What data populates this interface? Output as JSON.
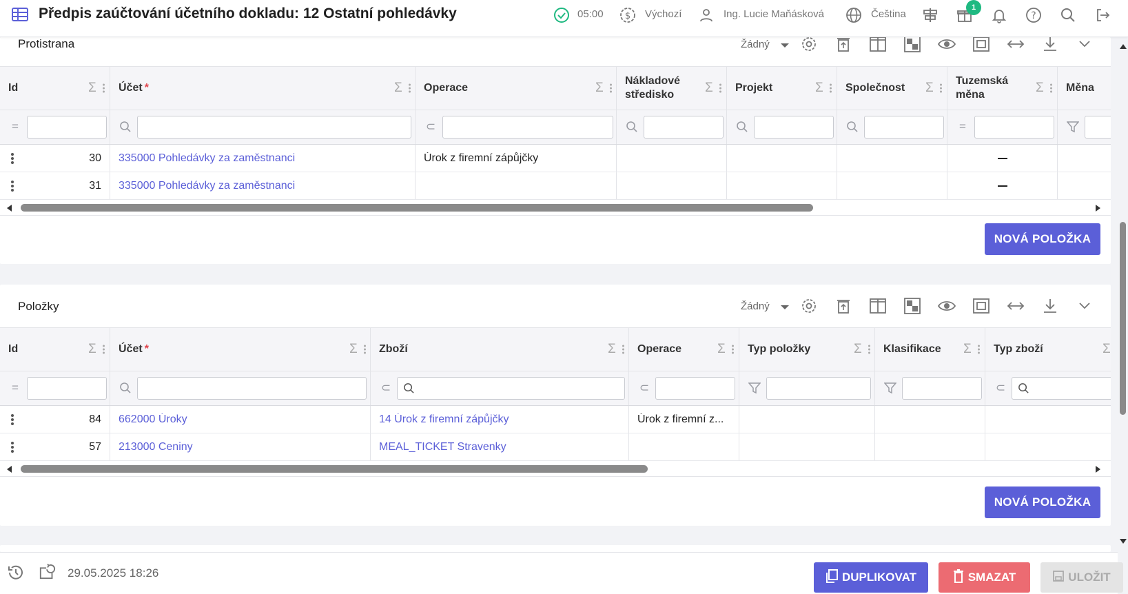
{
  "header": {
    "title": "Předpis zaúčtování účetního dokladu: 12 Ostatní pohledávky",
    "time": "05:00",
    "currency_label": "Výchozí",
    "user": "Ing. Lucie Maňásková",
    "language": "Čeština",
    "gift_badge": "1"
  },
  "protistrana": {
    "title": "Protistrana",
    "view_select": "Žádný",
    "columns": [
      {
        "label": "Id",
        "required": false
      },
      {
        "label": "Účet",
        "required": true
      },
      {
        "label": "Operace",
        "required": false
      },
      {
        "label": "Nákladové středisko",
        "required": false
      },
      {
        "label": "Projekt",
        "required": false
      },
      {
        "label": "Společnost",
        "required": false
      },
      {
        "label": "Tuzemská měna",
        "required": false
      },
      {
        "label": "Měna",
        "required": false
      }
    ],
    "rows": [
      {
        "id": "30",
        "ucet": "335000 Pohledávky za zaměstnanci",
        "operace": "Úrok z firemní zápůjčky",
        "tuzemska_mena": "–"
      },
      {
        "id": "31",
        "ucet": "335000 Pohledávky za zaměstnanci",
        "operace": "",
        "tuzemska_mena": "–"
      }
    ],
    "new_button": "NOVÁ POLOŽKA"
  },
  "polozky": {
    "title": "Položky",
    "view_select": "Žádný",
    "columns": [
      {
        "label": "Id",
        "required": false
      },
      {
        "label": "Účet",
        "required": true
      },
      {
        "label": "Zboží",
        "required": false
      },
      {
        "label": "Operace",
        "required": false
      },
      {
        "label": "Typ položky",
        "required": false
      },
      {
        "label": "Klasifikace",
        "required": false
      },
      {
        "label": "Typ zboží",
        "required": false
      }
    ],
    "rows": [
      {
        "id": "84",
        "ucet": "662000 Úroky",
        "zbozi": "14 Úrok z firemní zápůjčky",
        "operace": "Úrok z firemní z..."
      },
      {
        "id": "57",
        "ucet": "213000 Ceniny",
        "zbozi": "MEAL_TICKET Stravenky",
        "operace": ""
      }
    ],
    "new_button": "NOVÁ POLOŽKA"
  },
  "footer": {
    "timestamp": "29.05.2025 18:26",
    "duplicate": "DUPLIKOVAT",
    "delete": "SMAZAT",
    "save": "ULOŽIT"
  },
  "colors": {
    "primary": "#5b5fd8",
    "danger": "#ec6b72",
    "success": "#1fb981",
    "link": "#5b5fd8"
  },
  "icons": [
    "table-icon",
    "check-circle-icon",
    "dollar-icon",
    "user-icon",
    "globe-icon",
    "signpost-icon",
    "gift-icon",
    "bell-icon",
    "help-icon",
    "search-icon",
    "logout-icon",
    "gear-icon",
    "trash-icon",
    "columns-icon",
    "grid-icon",
    "eye-icon",
    "fit-icon",
    "swap-icon",
    "download-icon",
    "chevron-down-icon",
    "sigma-icon",
    "filter-icon",
    "history-icon",
    "share-icon",
    "copy-icon",
    "save-icon"
  ]
}
